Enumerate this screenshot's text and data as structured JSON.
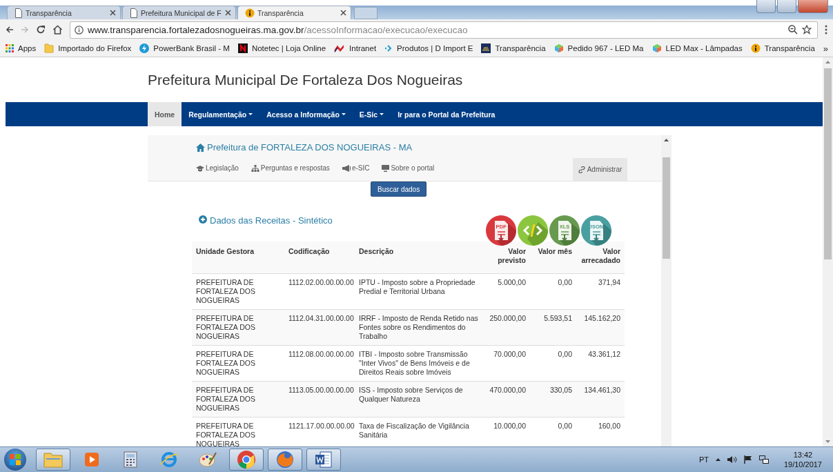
{
  "browser": {
    "tabs": [
      {
        "title": "Transparência",
        "selected": false
      },
      {
        "title": "Prefeitura Municipal de F",
        "selected": false
      },
      {
        "title": "Transparência",
        "selected": true
      }
    ],
    "address_bar": {
      "host": "www.transparencia.fortalezadosnogueiras.ma.gov.br",
      "path": "/acessoInformacao/execucao/execucao"
    },
    "bookmarks": [
      "Apps",
      "Importado do Firefox",
      "PowerBank Brasil - M",
      "Notetec | Loja Online",
      "Intranet",
      "Produtos | D Import E",
      "Transparência",
      "Pedido 967 - LED Ma",
      "LED Max - Lâmpadas",
      "Transparência"
    ],
    "bookmarks_more": "»"
  },
  "page": {
    "site_title": "Prefeitura Municipal De Fortaleza Dos Nogueiras",
    "nav": [
      {
        "label": "Home",
        "dropdown": false,
        "selected": true
      },
      {
        "label": "Regulamentação",
        "dropdown": true,
        "selected": false
      },
      {
        "label": "Acesso a Informação",
        "dropdown": true,
        "selected": false
      },
      {
        "label": "E-Sic",
        "dropdown": true,
        "selected": false
      },
      {
        "label": "Ir para o Portal da Prefeitura",
        "dropdown": false,
        "selected": false
      }
    ],
    "portal": {
      "title": "Prefeitura de FORTALEZA DOS NOGUEIRAS - MA",
      "links": [
        "Legislação",
        "Perguntas e respostas",
        "e-SIC",
        "Sobre o portal"
      ],
      "admin": "Administrar"
    },
    "search_button": "Buscar dados",
    "section_title": "Dados das Receitas - Sintético",
    "export_buttons": [
      {
        "kind": "pdf",
        "label": "PDF"
      },
      {
        "kind": "code"
      },
      {
        "kind": "xls",
        "label": "XLS"
      },
      {
        "kind": "json",
        "label": "JSON"
      }
    ],
    "table": {
      "columns": [
        "Unidade Gestora",
        "Codificação",
        "Descrição",
        "Valor previsto",
        "Valor mês",
        "Valor arrecadado"
      ],
      "rows": [
        [
          "PREFEITURA DE FORTALEZA DOS NOGUEIRAS",
          "1112.02.00.00.00.00",
          "IPTU - Imposto sobre a Propriedade Predial e Territorial Urbana",
          "5.000,00",
          "0,00",
          "371,94"
        ],
        [
          "PREFEITURA DE FORTALEZA DOS NOGUEIRAS",
          "1112.04.31.00.00.00",
          "IRRF - Imposto de Renda Retido nas Fontes sobre os Rendimentos do Trabalho",
          "250.000,00",
          "5.593,51",
          "145.162,20"
        ],
        [
          "PREFEITURA DE FORTALEZA DOS NOGUEIRAS",
          "1112.08.00.00.00.00",
          "ITBI - Imposto sobre Transmissão \"Inter Vivos\" de Bens Imóveis e de Direitos Reais sobre Imóveis",
          "70.000,00",
          "0,00",
          "43.361,12"
        ],
        [
          "PREFEITURA DE FORTALEZA DOS NOGUEIRAS",
          "1113.05.00.00.00.00",
          "ISS - Imposto sobre Serviços de Qualquer Natureza",
          "470.000,00",
          "330,05",
          "134.461,30"
        ],
        [
          "PREFEITURA DE FORTALEZA DOS NOGUEIRAS",
          "1121.17.00.00.00.00",
          "Taxa de Fiscalização de Vigilância Sanitária",
          "10.000,00",
          "0,00",
          "160,00"
        ]
      ]
    }
  },
  "taskbar": {
    "apps": [
      {
        "running": true
      },
      {
        "running": false
      },
      {
        "running": false
      },
      {
        "running": false
      },
      {
        "running": false
      },
      {
        "running": true
      },
      {
        "running": true
      },
      {
        "running": true
      }
    ],
    "language": "PT",
    "time": "13:42",
    "date": "19/10/2017"
  }
}
